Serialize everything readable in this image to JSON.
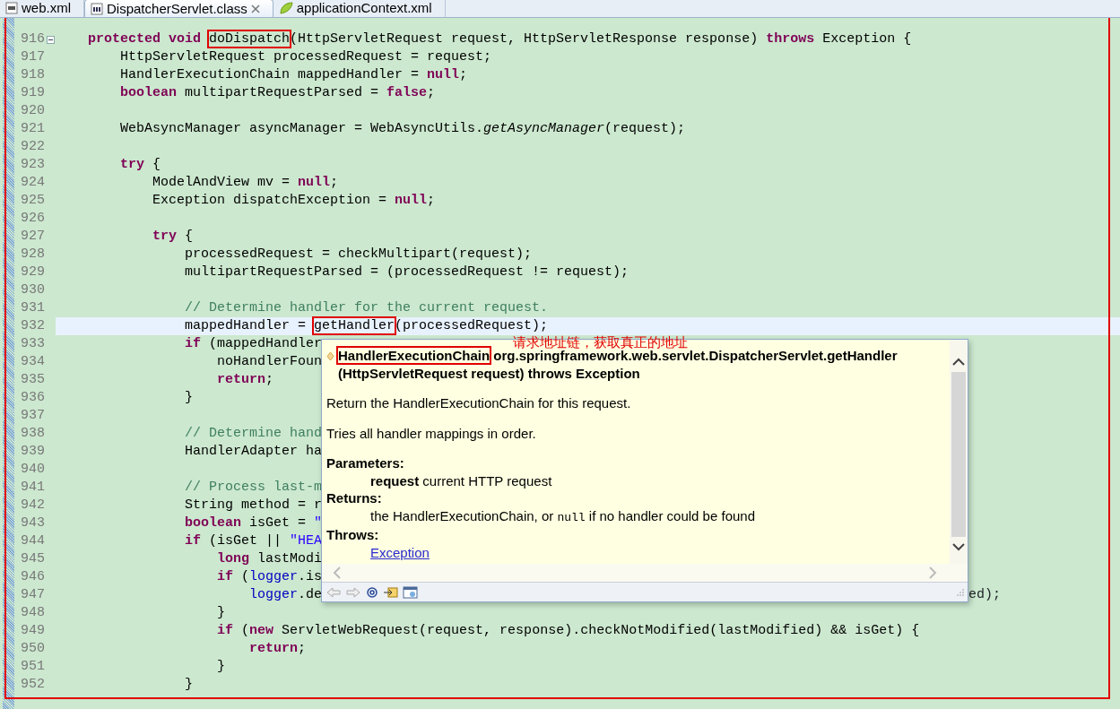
{
  "tabs": [
    {
      "label": "web.xml",
      "kind": "xml",
      "selected": false
    },
    {
      "label": "DispatcherServlet.class",
      "kind": "class",
      "selected": true
    },
    {
      "label": "applicationContext.xml",
      "kind": "spring",
      "selected": false
    }
  ],
  "editor": {
    "lines": [
      {
        "number": "916",
        "current": false,
        "fold": true,
        "segments": [
          {
            "kind": "keyword",
            "t": "    protected void "
          },
          {
            "kind": "plain",
            "t": "doDispatch",
            "marked": true
          },
          {
            "kind": "plain",
            "t": "(HttpServletRequest request, HttpServletResponse response) "
          },
          {
            "kind": "keyword",
            "t": "throws"
          },
          {
            "kind": "plain",
            "t": " Exception {"
          }
        ]
      },
      {
        "number": "917",
        "current": false,
        "segments": [
          {
            "kind": "plain",
            "t": "        HttpServletRequest processedRequest = request;"
          }
        ]
      },
      {
        "number": "918",
        "current": false,
        "segments": [
          {
            "kind": "plain",
            "t": "        HandlerExecutionChain mappedHandler = "
          },
          {
            "kind": "keyword",
            "t": "null"
          },
          {
            "kind": "plain",
            "t": ";"
          }
        ]
      },
      {
        "number": "919",
        "current": false,
        "segments": [
          {
            "kind": "keyword",
            "t": "        boolean"
          },
          {
            "kind": "plain",
            "t": " multipartRequestParsed = "
          },
          {
            "kind": "keyword",
            "t": "false"
          },
          {
            "kind": "plain",
            "t": ";"
          }
        ]
      },
      {
        "number": "920",
        "current": false
      },
      {
        "number": "921",
        "current": false,
        "segments": [
          {
            "kind": "plain",
            "t": "        WebAsyncManager asyncManager = WebAsyncUtils."
          },
          {
            "kind": "static",
            "t": "getAsyncManager"
          },
          {
            "kind": "plain",
            "t": "(request);"
          }
        ]
      },
      {
        "number": "922",
        "current": false
      },
      {
        "number": "923",
        "current": false,
        "segments": [
          {
            "kind": "keyword",
            "t": "        try"
          },
          {
            "kind": "plain",
            "t": " {"
          }
        ]
      },
      {
        "number": "924",
        "current": false,
        "segments": [
          {
            "kind": "plain",
            "t": "            ModelAndView mv = "
          },
          {
            "kind": "keyword",
            "t": "null"
          },
          {
            "kind": "plain",
            "t": ";"
          }
        ]
      },
      {
        "number": "925",
        "current": false,
        "segments": [
          {
            "kind": "plain",
            "t": "            Exception dispatchException = "
          },
          {
            "kind": "keyword",
            "t": "null"
          },
          {
            "kind": "plain",
            "t": ";"
          }
        ]
      },
      {
        "number": "926",
        "current": false
      },
      {
        "number": "927",
        "current": false,
        "segments": [
          {
            "kind": "keyword",
            "t": "            try"
          },
          {
            "kind": "plain",
            "t": " {"
          }
        ]
      },
      {
        "number": "928",
        "current": false,
        "segments": [
          {
            "kind": "plain",
            "t": "                processedRequest = checkMultipart(request);"
          }
        ]
      },
      {
        "number": "929",
        "current": false,
        "segments": [
          {
            "kind": "plain",
            "t": "                multipartRequestParsed = (processedRequest != request);"
          }
        ]
      },
      {
        "number": "930",
        "current": false
      },
      {
        "number": "931",
        "current": false,
        "segments": [
          {
            "kind": "comment",
            "t": "                // Determine handler for the current request."
          }
        ]
      },
      {
        "number": "932",
        "current": true,
        "segments": [
          {
            "kind": "plain",
            "t": "                mappedHandler = "
          },
          {
            "kind": "plain",
            "t": "getHandler",
            "marked": true
          },
          {
            "kind": "plain",
            "t": "(processedRequest);"
          }
        ]
      },
      {
        "number": "933",
        "current": false,
        "segments": [
          {
            "kind": "keyword",
            "t": "                if"
          },
          {
            "kind": "plain",
            "t": " (mappedHandler"
          }
        ]
      },
      {
        "number": "934",
        "current": false,
        "segments": [
          {
            "kind": "plain",
            "t": "                    noHandlerFoun"
          }
        ]
      },
      {
        "number": "935",
        "current": false,
        "segments": [
          {
            "kind": "keyword",
            "t": "                    return"
          },
          {
            "kind": "plain",
            "t": ";"
          }
        ]
      },
      {
        "number": "936",
        "current": false,
        "segments": [
          {
            "kind": "plain",
            "t": "                }"
          }
        ]
      },
      {
        "number": "937",
        "current": false
      },
      {
        "number": "938",
        "current": false,
        "segments": [
          {
            "kind": "comment",
            "t": "                // Determine hand"
          }
        ]
      },
      {
        "number": "939",
        "current": false,
        "segments": [
          {
            "kind": "plain",
            "t": "                HandlerAdapter ha"
          }
        ]
      },
      {
        "number": "940",
        "current": false
      },
      {
        "number": "941",
        "current": false,
        "segments": [
          {
            "kind": "comment",
            "t": "                // Process last-m"
          }
        ]
      },
      {
        "number": "942",
        "current": false,
        "segments": [
          {
            "kind": "plain",
            "t": "                String method = r"
          }
        ]
      },
      {
        "number": "943",
        "current": false,
        "segments": [
          {
            "kind": "keyword",
            "t": "                boolean"
          },
          {
            "kind": "plain",
            "t": " isGet = "
          },
          {
            "kind": "string",
            "t": "\""
          }
        ]
      },
      {
        "number": "944",
        "current": false,
        "segments": [
          {
            "kind": "keyword",
            "t": "                if"
          },
          {
            "kind": "plain",
            "t": " (isGet || "
          },
          {
            "kind": "string",
            "t": "\"HEA"
          }
        ]
      },
      {
        "number": "945",
        "current": false,
        "segments": [
          {
            "kind": "keyword",
            "t": "                    long"
          },
          {
            "kind": "plain",
            "t": " lastModi"
          }
        ]
      },
      {
        "number": "946",
        "current": false,
        "segments": [
          {
            "kind": "keyword",
            "t": "                    if"
          },
          {
            "kind": "plain",
            "t": " ("
          },
          {
            "kind": "field",
            "t": "logger"
          },
          {
            "kind": "plain",
            "t": ".is"
          }
        ]
      },
      {
        "number": "947",
        "current": false,
        "segments": [
          {
            "kind": "field",
            "t": "                        logger"
          },
          {
            "kind": "plain",
            "t": ".de"
          }
        ],
        "after_popup": [
          {
            "kind": "plain",
            "t": "ed);"
          }
        ]
      },
      {
        "number": "948",
        "current": false,
        "segments": [
          {
            "kind": "plain",
            "t": "                    }"
          }
        ]
      },
      {
        "number": "949",
        "current": false,
        "segments": [
          {
            "kind": "keyword",
            "t": "                    if"
          },
          {
            "kind": "plain",
            "t": " ("
          },
          {
            "kind": "keyword",
            "t": "new"
          },
          {
            "kind": "plain",
            "t": " ServletWebRequest(request, response).checkNotModified(lastModified) && isGet) {"
          }
        ]
      },
      {
        "number": "950",
        "current": false,
        "segments": [
          {
            "kind": "keyword",
            "t": "                        return"
          },
          {
            "kind": "plain",
            "t": ";"
          }
        ]
      },
      {
        "number": "951",
        "current": false,
        "segments": [
          {
            "kind": "plain",
            "t": "                    }"
          }
        ]
      },
      {
        "number": "952",
        "current": false,
        "segments": [
          {
            "kind": "plain",
            "t": "                }"
          }
        ]
      }
    ]
  },
  "popup": {
    "annotation": "请求地址链，获取真正的地址",
    "signature": [
      {
        "t": "HandlerExecutionChain",
        "marked": true
      },
      {
        "t": " org.springframework.web.servlet.DispatcherServlet.getHandler (HttpServletRequest request) throws Exception"
      }
    ],
    "paragraphs": [
      "Return the HandlerExecutionChain for this request.",
      "Tries all handler mappings in order."
    ],
    "sections": [
      {
        "heading": "Parameters:",
        "items": [
          [
            {
              "t": "**request** current HTTP request"
            }
          ]
        ]
      },
      {
        "heading": "Returns:",
        "items": [
          [
            {
              "t": "the HandlerExecutionChain, or "
            },
            {
              "t": "null",
              "code": true
            },
            {
              "t": " if no handler could be found"
            }
          ]
        ]
      },
      {
        "heading": "Throws:",
        "items": [
          [
            {
              "t": "Exception",
              "link": true
            }
          ]
        ]
      }
    ]
  }
}
